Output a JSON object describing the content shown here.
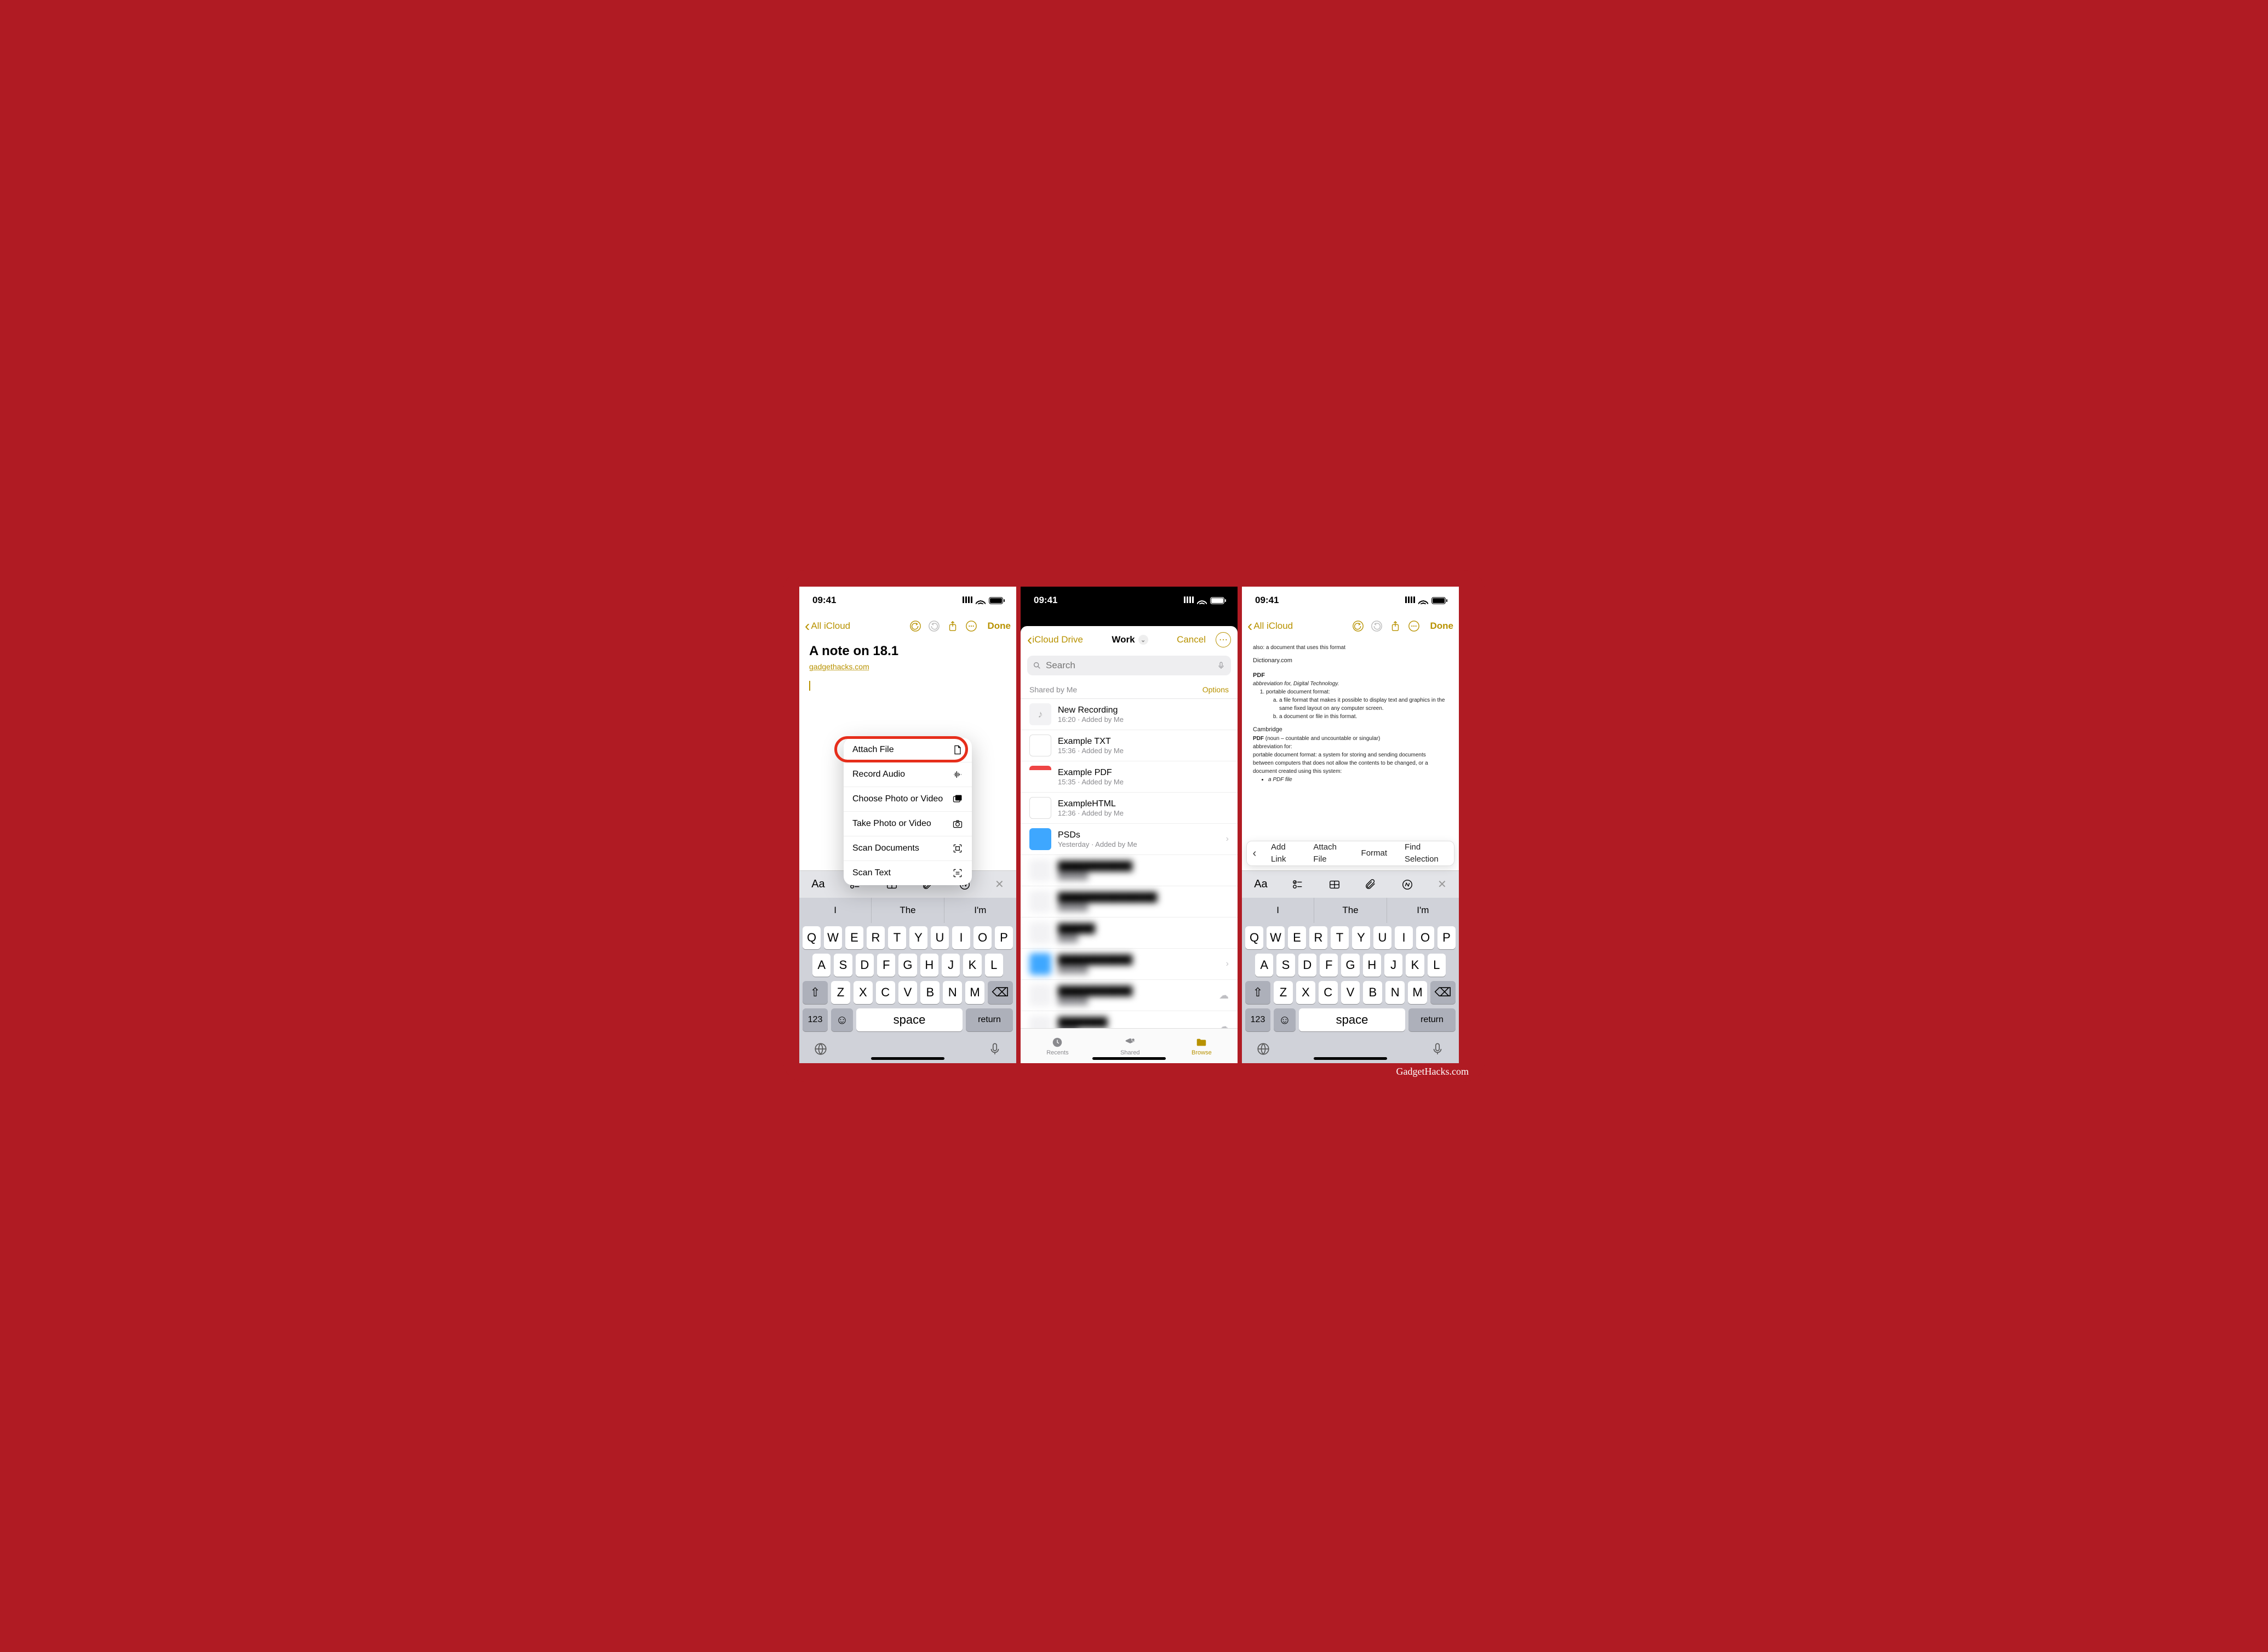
{
  "credit": "GadgetHacks.com",
  "status_time": "09:41",
  "phone1": {
    "nav": {
      "back": "All iCloud",
      "done": "Done"
    },
    "note": {
      "title": "A note on 18.1",
      "link": "gadgethacks.com"
    },
    "popup": [
      {
        "label": "Attach File",
        "icon": "document-icon"
      },
      {
        "label": "Record Audio",
        "icon": "audio-wave-icon"
      },
      {
        "label": "Choose Photo or Video",
        "icon": "photo-library-icon"
      },
      {
        "label": "Take Photo or Video",
        "icon": "camera-icon"
      },
      {
        "label": "Scan Documents",
        "icon": "scan-doc-icon"
      },
      {
        "label": "Scan Text",
        "icon": "scan-text-icon"
      }
    ]
  },
  "phone2": {
    "nav": {
      "back": "iCloud Drive",
      "title": "Work",
      "cancel": "Cancel"
    },
    "search_placeholder": "Search",
    "section": {
      "header": "Shared by Me",
      "options": "Options"
    },
    "files": [
      {
        "name": "New Recording",
        "sub": "16:20 · Added by Me",
        "thumb": "audio"
      },
      {
        "name": "Example TXT",
        "sub": "15:36 · Added by Me",
        "thumb": "txt"
      },
      {
        "name": "Example PDF",
        "sub": "15:35 · Added by Me",
        "thumb": "pdf"
      },
      {
        "name": "ExampleHTML",
        "sub": "12:36 · Added by Me",
        "thumb": "txt"
      },
      {
        "name": "PSDs",
        "sub": "Yesterday · Added by Me",
        "thumb": "folder",
        "chevron": true
      }
    ],
    "tabs": {
      "recents": "Recents",
      "shared": "Shared",
      "browse": "Browse"
    }
  },
  "phone3": {
    "nav": {
      "back": "All iCloud",
      "done": "Done"
    },
    "doc": {
      "line0": "also: a document that uses this format",
      "src1": "Dictionary.com",
      "h1": "PDF",
      "abbr1": "abbreviation for, Digital Technology.",
      "ol1": "portable document format:",
      "ol1a": "a file format that makes it possible to display text and graphics in the same fixed layout on any computer screen.",
      "ol1b": "a document or file in this format.",
      "src2": "Cambridge",
      "h2": "PDF",
      "h2sub": "(noun – countable and uncountable or singular)",
      "abbr2": "abbreviation for:",
      "def2": "portable document format: a system for storing and sending documents between computers that does not allow the contents to be changed, or a document created using this system:",
      "bullet2": "a PDF file"
    },
    "context": [
      "Add Link",
      "Attach File",
      "Format",
      "Find Selection"
    ]
  },
  "keyboard": {
    "suggestions": [
      "I",
      "The",
      "I'm"
    ],
    "row1": [
      "Q",
      "W",
      "E",
      "R",
      "T",
      "Y",
      "U",
      "I",
      "O",
      "P"
    ],
    "row2": [
      "A",
      "S",
      "D",
      "F",
      "G",
      "H",
      "J",
      "K",
      "L"
    ],
    "row3": [
      "Z",
      "X",
      "C",
      "V",
      "B",
      "N",
      "M"
    ],
    "num": "123",
    "space": "space",
    "return": "return"
  }
}
